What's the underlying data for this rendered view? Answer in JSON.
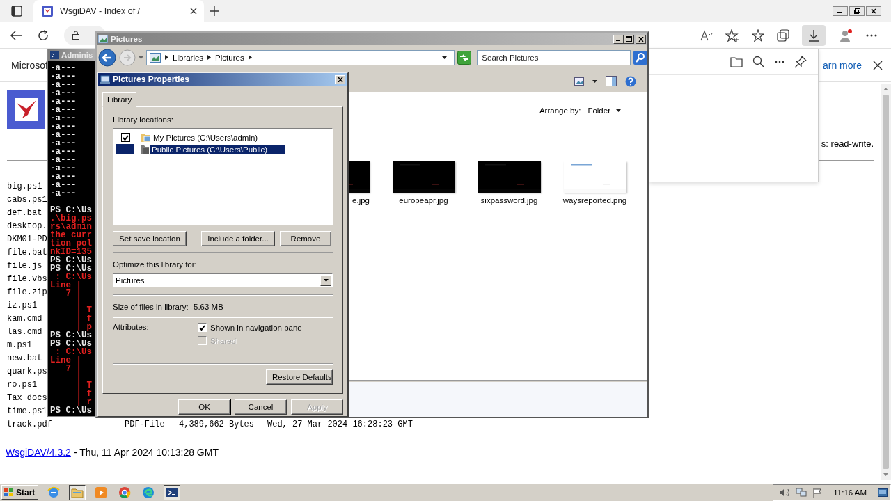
{
  "browser": {
    "tab": {
      "title": "WsgiDAV - Index of /",
      "selected": true
    },
    "downloads_panel_open": true,
    "infobar": {
      "message": "Microsof",
      "link": "arn more"
    }
  },
  "page": {
    "status_text": "s: read-write.",
    "files": [
      {
        "name": "big.ps1"
      },
      {
        "name": "cabs.ps1"
      },
      {
        "name": "def.bat"
      },
      {
        "name": "desktop."
      },
      {
        "name": "DKM01-PD"
      },
      {
        "name": "file.bat"
      },
      {
        "name": "file.js"
      },
      {
        "name": "file.vbs"
      },
      {
        "name": "file.zip"
      },
      {
        "name": "iz.ps1"
      },
      {
        "name": "kam.cmd"
      },
      {
        "name": "las.cmd"
      },
      {
        "name": "m.ps1"
      },
      {
        "name": "new.bat"
      },
      {
        "name": "quark.ps"
      },
      {
        "name": "ro.ps1"
      },
      {
        "name": "Tax_docs"
      },
      {
        "name": "time.ps1"
      },
      {
        "name": "track.pdf",
        "type": "PDF-File",
        "size": "4,389,662 Bytes",
        "modified": "Wed, 27 Mar 2024 16:28:23 GMT"
      }
    ],
    "footer": {
      "link": "WsgiDAV/4.3.2",
      "text": "- Thu, 11 Apr 2024 10:13:28 GMT"
    }
  },
  "console": {
    "title": "Adminis",
    "lines": [
      {
        "text": "-a---",
        "kind": "out"
      },
      {
        "text": "-a---",
        "kind": "out"
      },
      {
        "text": "-a---",
        "kind": "out"
      },
      {
        "text": "-a---",
        "kind": "out"
      },
      {
        "text": "-a---",
        "kind": "out"
      },
      {
        "text": "-a---",
        "kind": "out"
      },
      {
        "text": "-a---",
        "kind": "out"
      },
      {
        "text": "-a---",
        "kind": "out"
      },
      {
        "text": "-a---",
        "kind": "out"
      },
      {
        "text": "-a---",
        "kind": "out"
      },
      {
        "text": "-a---",
        "kind": "out"
      },
      {
        "text": "-a---",
        "kind": "out"
      },
      {
        "text": "-a---",
        "kind": "out"
      },
      {
        "text": "-a---",
        "kind": "out"
      },
      {
        "text": "-a---",
        "kind": "out"
      },
      {
        "text": "-a---",
        "kind": "out"
      },
      {
        "text": "PS C:\\Us",
        "kind": "out",
        "gap_before": true
      },
      {
        "text": ".\\big.ps",
        "kind": "error"
      },
      {
        "text": "rs\\admin",
        "kind": "error"
      },
      {
        "text": "the curr",
        "kind": "error"
      },
      {
        "text": "tion pol",
        "kind": "error"
      },
      {
        "text": "nkID=135",
        "kind": "error"
      },
      {
        "text": "PS C:\\Us",
        "kind": "out"
      },
      {
        "text": "PS C:\\Us",
        "kind": "out"
      },
      {
        "text": " : C:\\Us",
        "kind": "error"
      },
      {
        "text": "Line |",
        "kind": "error"
      },
      {
        "text": "   7 |",
        "kind": "error"
      },
      {
        "text": "     |",
        "kind": "error"
      },
      {
        "text": "     | T",
        "kind": "error"
      },
      {
        "text": "     | f",
        "kind": "error"
      },
      {
        "text": "     | p",
        "kind": "error"
      },
      {
        "text": "PS C:\\Us",
        "kind": "out"
      },
      {
        "text": "PS C:\\Us",
        "kind": "out"
      },
      {
        "text": " : C:\\Us",
        "kind": "error"
      },
      {
        "text": "Line |",
        "kind": "error"
      },
      {
        "text": "   7 |",
        "kind": "error"
      },
      {
        "text": "     |",
        "kind": "error"
      },
      {
        "text": "     | T",
        "kind": "error"
      },
      {
        "text": "     | f",
        "kind": "error"
      },
      {
        "text": "     | r",
        "kind": "error"
      },
      {
        "text": "PS C:\\Us",
        "kind": "out"
      }
    ]
  },
  "explorer": {
    "title": "Pictures",
    "breadcrumb": [
      "Libraries",
      "Pictures"
    ],
    "search": {
      "placeholder": "Search Pictures"
    },
    "arrange_label": "Arrange by:",
    "arrange_value": "Folder",
    "items": [
      {
        "name": "e.jpg",
        "color": "#000000"
      },
      {
        "name": "europeapr.jpg",
        "color": "#000000"
      },
      {
        "name": "sixpassword.jpg",
        "color": "#000000"
      },
      {
        "name": "waysreported.png",
        "color": "#ffffff"
      }
    ]
  },
  "dialog": {
    "title": "Pictures Properties",
    "tab": {
      "label": "Library",
      "selected": true
    },
    "locations_label": "Library locations:",
    "locations": [
      {
        "label": "My Pictures (C:\\Users\\admin)",
        "checked": true,
        "selected": false
      },
      {
        "label": "Public Pictures (C:\\Users\\Public)",
        "checked": false,
        "selected": true
      }
    ],
    "location_buttons": [
      "Set save location",
      "Include a folder...",
      "Remove"
    ],
    "optimize_label": "Optimize this library for:",
    "optimize_value": "Pictures",
    "size_label": "Size of files in library:",
    "size_value": "5.63 MB",
    "attributes_label": "Attributes:",
    "attributes": [
      {
        "label": "Shown in navigation pane",
        "checked": true,
        "disabled": false
      },
      {
        "label": "Shared",
        "checked": false,
        "disabled": true
      }
    ],
    "restore_button": "Restore Defaults",
    "buttons": [
      {
        "label": "OK",
        "default": true,
        "disabled": false
      },
      {
        "label": "Cancel",
        "default": false,
        "disabled": false
      },
      {
        "label": "Apply",
        "default": false,
        "disabled": true
      }
    ]
  },
  "taskbar": {
    "start": "Start",
    "apps": [
      {
        "kind": "ie",
        "active": false
      },
      {
        "kind": "explorer",
        "active": true
      },
      {
        "kind": "media",
        "active": false
      },
      {
        "kind": "chrome",
        "active": false
      },
      {
        "kind": "edge",
        "active": false
      },
      {
        "kind": "powershell",
        "active": true
      }
    ],
    "clock": "11:16 AM"
  }
}
